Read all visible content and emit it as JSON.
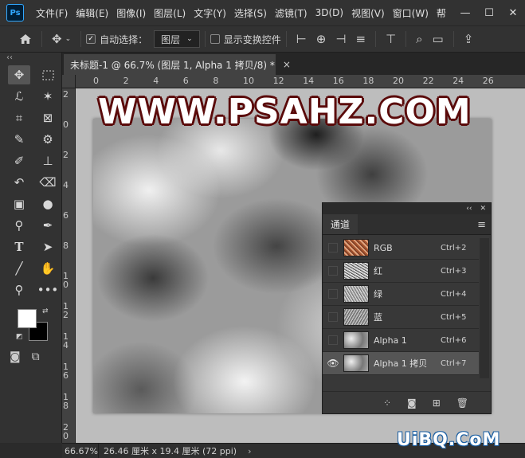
{
  "app": {
    "logo": "Ps",
    "menu": [
      "文件(F)",
      "编辑(E)",
      "图像(I)",
      "图层(L)",
      "文字(Y)",
      "选择(S)",
      "滤镜(T)",
      "3D(D)",
      "视图(V)",
      "窗口(W)",
      "帮"
    ],
    "window_controls": {
      "minimize": "—",
      "maximize": "☐",
      "close": "✕"
    }
  },
  "options": {
    "auto_select_label": "自动选择：",
    "auto_select_checked": true,
    "target_value": "图层",
    "show_transform_label": "显示变换控件",
    "show_transform_checked": false
  },
  "document": {
    "tab_title": "未标题-1 @ 66.7% (图层 1, Alpha 1 拷贝/8) *",
    "close": "×",
    "ruler_top": [
      "0",
      "2",
      "4",
      "6",
      "8",
      "10",
      "12",
      "14",
      "16",
      "18",
      "20",
      "22",
      "24",
      "26"
    ],
    "ruler_left": [
      "2",
      "0",
      "2",
      "4",
      "6",
      "8",
      "1 0",
      "1 2",
      "1 4",
      "1 6",
      "1 8",
      "2 0"
    ],
    "watermark": "WWW.PSAHZ.COM"
  },
  "status": {
    "zoom": "66.67%",
    "doc_size": "26.46 厘米 x 19.4 厘米 (72 ppi)",
    "arrow": "›"
  },
  "channels_panel": {
    "tab": "通道",
    "collapse": "‹‹",
    "close": "✕",
    "menu": "≡",
    "rows": [
      {
        "name": "RGB",
        "shortcut": "Ctrl+2",
        "visible": false,
        "selected": false
      },
      {
        "name": "红",
        "shortcut": "Ctrl+3",
        "visible": false,
        "selected": false
      },
      {
        "name": "绿",
        "shortcut": "Ctrl+4",
        "visible": false,
        "selected": false
      },
      {
        "name": "蓝",
        "shortcut": "Ctrl+5",
        "visible": false,
        "selected": false
      },
      {
        "name": "Alpha 1",
        "shortcut": "Ctrl+6",
        "visible": false,
        "selected": false
      },
      {
        "name": "Alpha 1 拷贝",
        "shortcut": "Ctrl+7",
        "visible": true,
        "selected": true
      }
    ]
  },
  "site_watermark": "UiBQ.CoM"
}
